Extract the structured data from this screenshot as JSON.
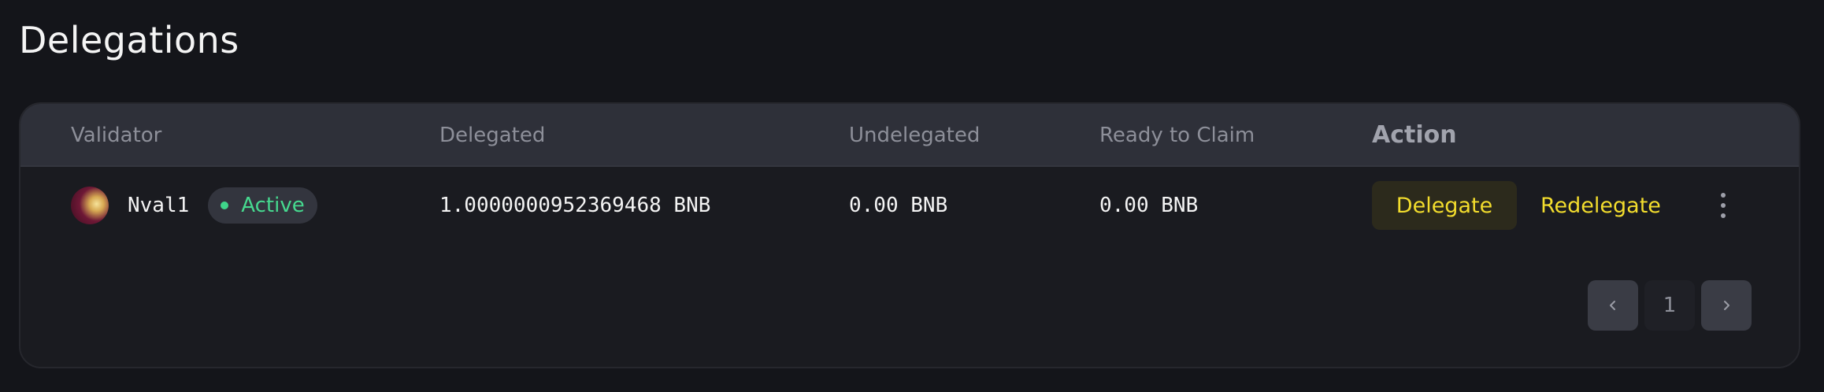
{
  "page": {
    "title": "Delegations"
  },
  "table": {
    "headers": {
      "validator": "Validator",
      "delegated": "Delegated",
      "undelegated": "Undelegated",
      "ready_to_claim": "Ready to Claim",
      "action": "Action"
    },
    "rows": [
      {
        "validator_name": "Nval1",
        "avatar": "validator-avatar",
        "status": "Active",
        "status_color": "#46d98f",
        "delegated": "1.0000000952369468 BNB",
        "undelegated": "0.00 BNB",
        "ready_to_claim": "0.00 BNB",
        "actions": {
          "delegate_label": "Delegate",
          "redelegate_label": "Redelegate",
          "more_icon": "more-vertical-icon"
        }
      }
    ]
  },
  "pagination": {
    "prev_icon": "chevron-left-icon",
    "current_page": "1",
    "next_icon": "chevron-right-icon"
  },
  "colors": {
    "accent": "#f3dd2d",
    "background": "#14151a",
    "card": "#1a1b20",
    "header": "#2e3039"
  }
}
